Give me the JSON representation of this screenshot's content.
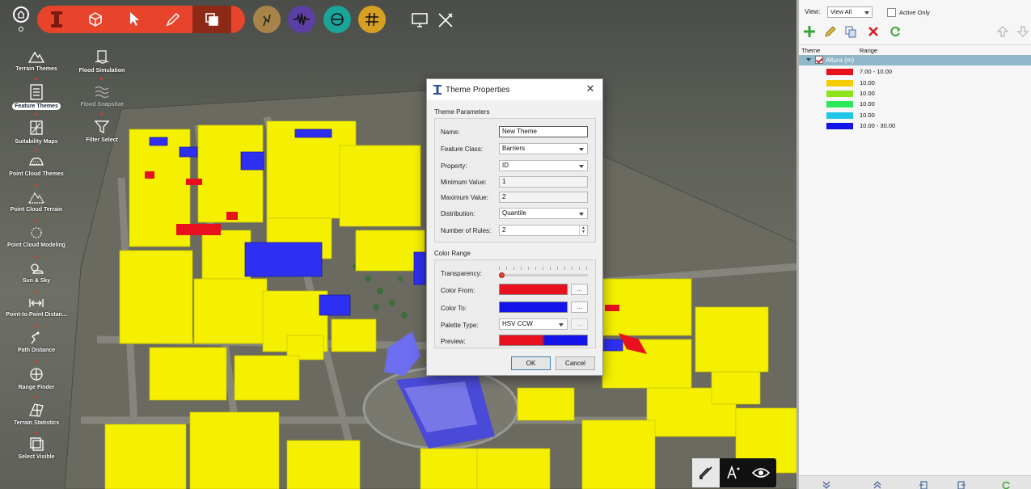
{
  "left_panel": {
    "items": [
      {
        "label": "Terrain Themes"
      },
      {
        "label": "Feature Themes"
      },
      {
        "label": "Suitability Maps"
      },
      {
        "label": "Point Cloud Themes"
      },
      {
        "label": "Point Cloud Terrain"
      },
      {
        "label": "Point Cloud Modeling"
      },
      {
        "label": "Sun & Sky"
      },
      {
        "label": "Point-to-Point Distan..."
      },
      {
        "label": "Path Distance"
      },
      {
        "label": "Range Finder"
      },
      {
        "label": "Terrain Statistics"
      },
      {
        "label": "Select Visible"
      }
    ],
    "column2": [
      {
        "label": "Flood Simulation"
      },
      {
        "label": "Flood Snapshot"
      },
      {
        "label": "Filter Select"
      }
    ]
  },
  "dialog": {
    "title": "Theme Properties",
    "section_params": "Theme Parameters",
    "name_label": "Name:",
    "name_value": "New Theme",
    "feature_class_label": "Feature Class:",
    "feature_class_value": "Barriers",
    "property_label": "Property:",
    "property_value": "ID",
    "min_label": "Minimum Value:",
    "min_value": "1",
    "max_label": "Maximum Value:",
    "max_value": "2",
    "distribution_label": "Distribution:",
    "distribution_value": "Quantile",
    "rules_label": "Number of Rules:",
    "rules_value": "2",
    "section_color": "Color Range",
    "transparency_label": "Transparency:",
    "transparency_value": 0,
    "color_from_label": "Color From:",
    "color_from": "#e8101c",
    "color_to_label": "Color To:",
    "color_to": "#1414ea",
    "palette_label": "Palette  Type:",
    "palette_value": "HSV CCW",
    "preview_label": "Preview:",
    "dots": "...",
    "ok_label": "OK",
    "cancel_label": "Cancel"
  },
  "right_panel": {
    "view_label": "View:",
    "view_value": "View All",
    "active_only_label": "Active Only",
    "col_theme": "Theme",
    "col_range": "Range",
    "theme_name": "Altura (m)",
    "ranges": [
      {
        "color": "#e8101c",
        "range": "7.00 - 10.00"
      },
      {
        "color": "#f5cc00",
        "range": "10.00"
      },
      {
        "color": "#8de21a",
        "range": "10.00"
      },
      {
        "color": "#2ee65a",
        "range": "10.00"
      },
      {
        "color": "#20c6e8",
        "range": "10.00"
      },
      {
        "color": "#1414ea",
        "range": "10.00 - 30.00"
      }
    ]
  }
}
